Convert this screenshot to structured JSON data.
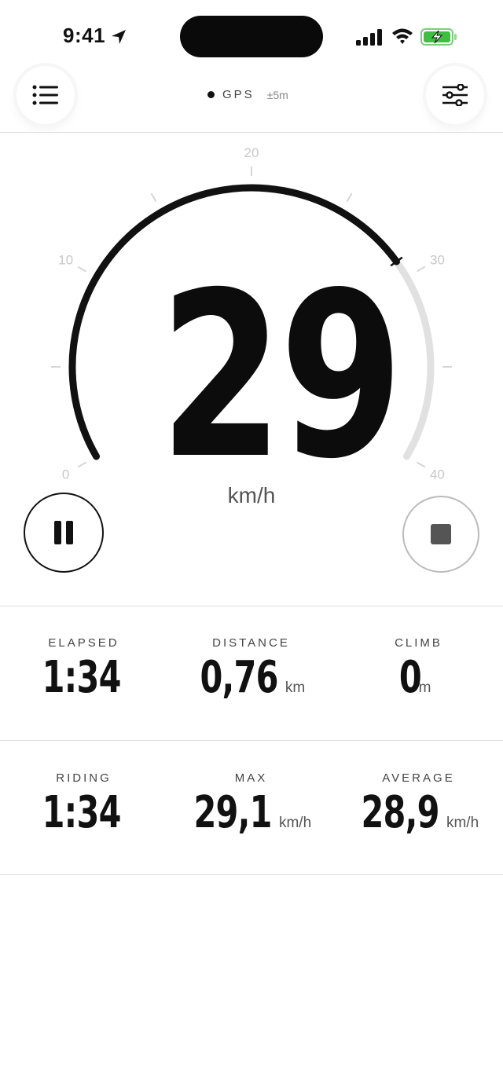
{
  "status_bar": {
    "time": "9:41"
  },
  "toolbar": {
    "menu_icon": "list-icon",
    "settings_icon": "sliders-icon",
    "gps_label": "GPS",
    "gps_accuracy": "±5m"
  },
  "gauge": {
    "min": 0,
    "max": 40,
    "value": 29,
    "ticks": [
      "0",
      "10",
      "20",
      "30",
      "40"
    ],
    "unit": "km/h",
    "active_color": "#111111",
    "track_color": "#e1e1e1"
  },
  "controls": {
    "pause_icon": "pause-icon",
    "stop_icon": "stop-icon"
  },
  "stats": {
    "elapsed": {
      "label": "ELAPSED",
      "value": "1:34",
      "unit": ""
    },
    "distance": {
      "label": "DISTANCE",
      "value": "0,76",
      "unit": "km"
    },
    "climb": {
      "label": "CLIMB",
      "value": "0",
      "unit": "m"
    },
    "riding": {
      "label": "RIDING",
      "value": "1:34",
      "unit": ""
    },
    "max": {
      "label": "MAX",
      "value": "29,1",
      "unit": "km/h"
    },
    "average": {
      "label": "AVERAGE",
      "value": "28,9",
      "unit": "km/h"
    }
  }
}
